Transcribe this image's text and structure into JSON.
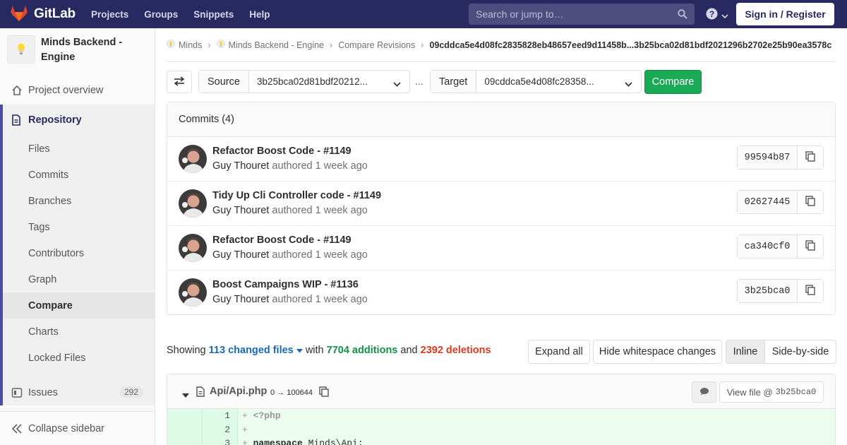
{
  "navbar": {
    "brand": "GitLab",
    "links": [
      "Projects",
      "Groups",
      "Snippets",
      "Help"
    ],
    "search_placeholder": "Search or jump to…",
    "signin": "Sign in / Register",
    "brand_color": "#292961"
  },
  "sidebar": {
    "project_name": "Minds Backend - Engine",
    "overview": "Project overview",
    "repository": "Repository",
    "repo_items": [
      "Files",
      "Commits",
      "Branches",
      "Tags",
      "Contributors",
      "Graph",
      "Compare",
      "Charts",
      "Locked Files"
    ],
    "active_item": "Compare",
    "issues": "Issues",
    "issues_count": "292",
    "collapse": "Collapse sidebar"
  },
  "breadcrumb": {
    "items": [
      "Minds",
      "Minds Backend - Engine",
      "Compare Revisions"
    ],
    "current": "09cddca5e4d08fc2835828eb48657eed9d11458b...3b25bca02d81bdf2021296b2702e25b90ea3578c"
  },
  "compare": {
    "source_label": "Source",
    "source_value": "3b25bca02d81bdf20212...",
    "ellipsis": "...",
    "target_label": "Target",
    "target_value": "09cddca5e4d08fc28358...",
    "compare_button": "Compare"
  },
  "commits": {
    "header": "Commits (4)",
    "items": [
      {
        "title": "Refactor Boost Code - #1149",
        "author": "Guy Thouret",
        "action": "authored",
        "time": "1 week ago",
        "sha": "99594b87"
      },
      {
        "title": "Tidy Up Cli Controller code - #1149",
        "author": "Guy Thouret",
        "action": "authored",
        "time": "1 week ago",
        "sha": "02627445"
      },
      {
        "title": "Refactor Boost Code - #1149",
        "author": "Guy Thouret",
        "action": "authored",
        "time": "1 week ago",
        "sha": "ca340cf0"
      },
      {
        "title": "Boost Campaigns WIP - #1136",
        "author": "Guy Thouret",
        "action": "authored",
        "time": "1 week ago",
        "sha": "3b25bca0"
      }
    ]
  },
  "diff_summary": {
    "showing": "Showing",
    "changed_files": "113 changed files",
    "with": "with",
    "additions": "7704 additions",
    "and": "and",
    "deletions": "2392 deletions",
    "expand_all": "Expand all",
    "hide_whitespace": "Hide whitespace changes",
    "inline": "Inline",
    "side_by_side": "Side-by-side"
  },
  "file": {
    "name": "Api/Api.php",
    "mode": "0 → 100644",
    "view_file_label": "View file @",
    "view_file_sha": "3b25bca0",
    "lines": [
      {
        "num": "1",
        "prefix": "+",
        "code": "<?php"
      },
      {
        "num": "2",
        "prefix": "+",
        "code": ""
      },
      {
        "num": "3",
        "prefix": "+",
        "code_kw": "namespace",
        "code": " Minds\\Api;"
      }
    ]
  }
}
